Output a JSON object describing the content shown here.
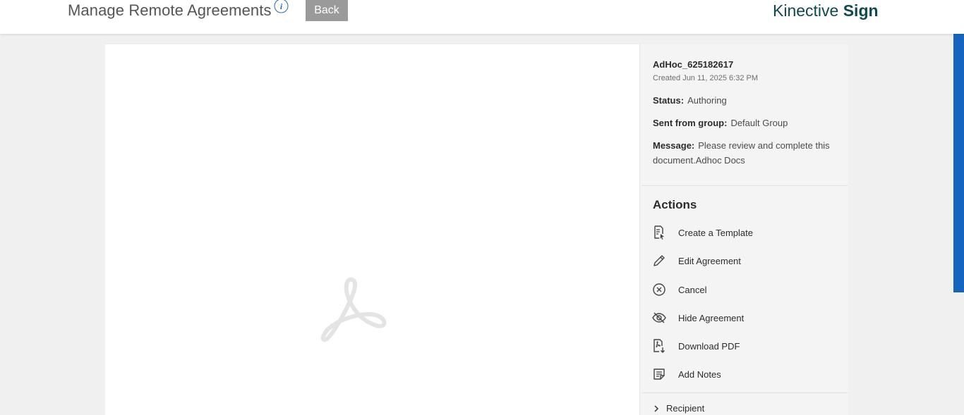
{
  "header": {
    "title": "Manage Remote Agreements",
    "info_icon": "info-icon",
    "back_label": "Back",
    "brand_prefix": "Kinective ",
    "brand_bold": "Sign"
  },
  "colors": {
    "brand": "#0e4a50",
    "back_button": "#9a9a9a",
    "scroll_indicator": "#1565c0"
  },
  "document": {
    "placeholder_icon": "acrobat-logo-icon"
  },
  "agreement": {
    "name": "AdHoc_625182617",
    "created": "Created Jun 11, 2025 6:32 PM",
    "status_label": "Status:",
    "status_value": "Authoring",
    "group_label": "Sent from group:",
    "group_value": "Default Group",
    "message_label": "Message:",
    "message_value": "Please review and complete this document.Adhoc Docs"
  },
  "actions": {
    "title": "Actions",
    "items": [
      {
        "label": "Create a Template",
        "icon": "template-icon"
      },
      {
        "label": "Edit Agreement",
        "icon": "pencil-icon"
      },
      {
        "label": "Cancel",
        "icon": "cancel-circle-icon"
      },
      {
        "label": "Hide Agreement",
        "icon": "eye-hidden-icon"
      },
      {
        "label": "Download PDF",
        "icon": "download-pdf-icon"
      },
      {
        "label": "Add Notes",
        "icon": "notes-icon"
      }
    ]
  },
  "recipient": {
    "label": "Recipient",
    "icon": "chevron-right-icon"
  }
}
